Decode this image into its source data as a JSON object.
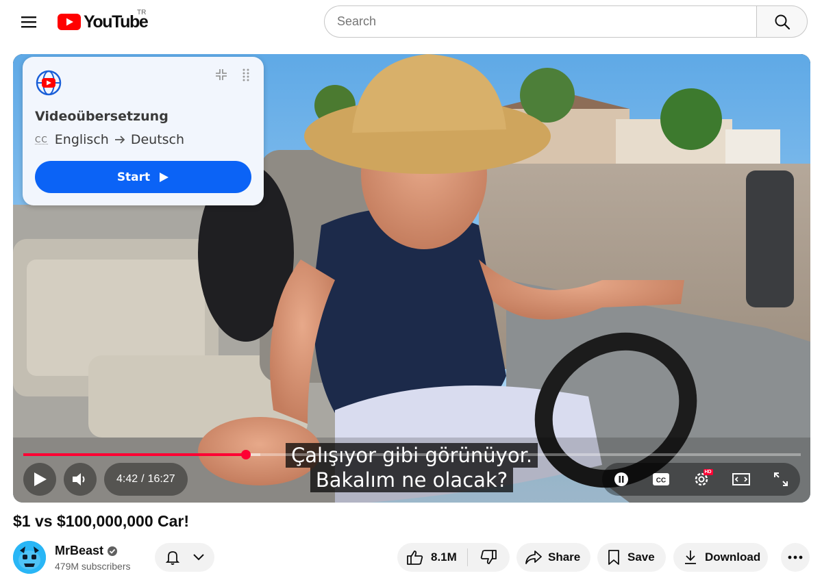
{
  "header": {
    "logo_text": "YouTube",
    "region_code": "TR",
    "search_placeholder": "Search"
  },
  "player": {
    "subtitle_lines": [
      "Çalışıyor gibi görünüyor.",
      "Bakalım ne olacak?"
    ],
    "current_time": "4:42",
    "time_separator": "/",
    "duration": "16:27",
    "played_fraction": 0.286,
    "loaded_fraction": 0.305,
    "settings_badge": "HD",
    "colors": {
      "progress": "#ff0033"
    }
  },
  "translation_card": {
    "title": "Videoübersetzung",
    "cc_label": "CC",
    "source_language": "Englisch",
    "target_language": "Deutsch",
    "start_label": "Start",
    "colors": {
      "button": "#0b63f6",
      "background": "#f2f6fd"
    }
  },
  "video": {
    "title": "$1 vs $100,000,000 Car!",
    "channel_name": "MrBeast",
    "subscribers": "479M subscribers",
    "likes": "8.1M",
    "share_label": "Share",
    "save_label": "Save",
    "download_label": "Download"
  }
}
